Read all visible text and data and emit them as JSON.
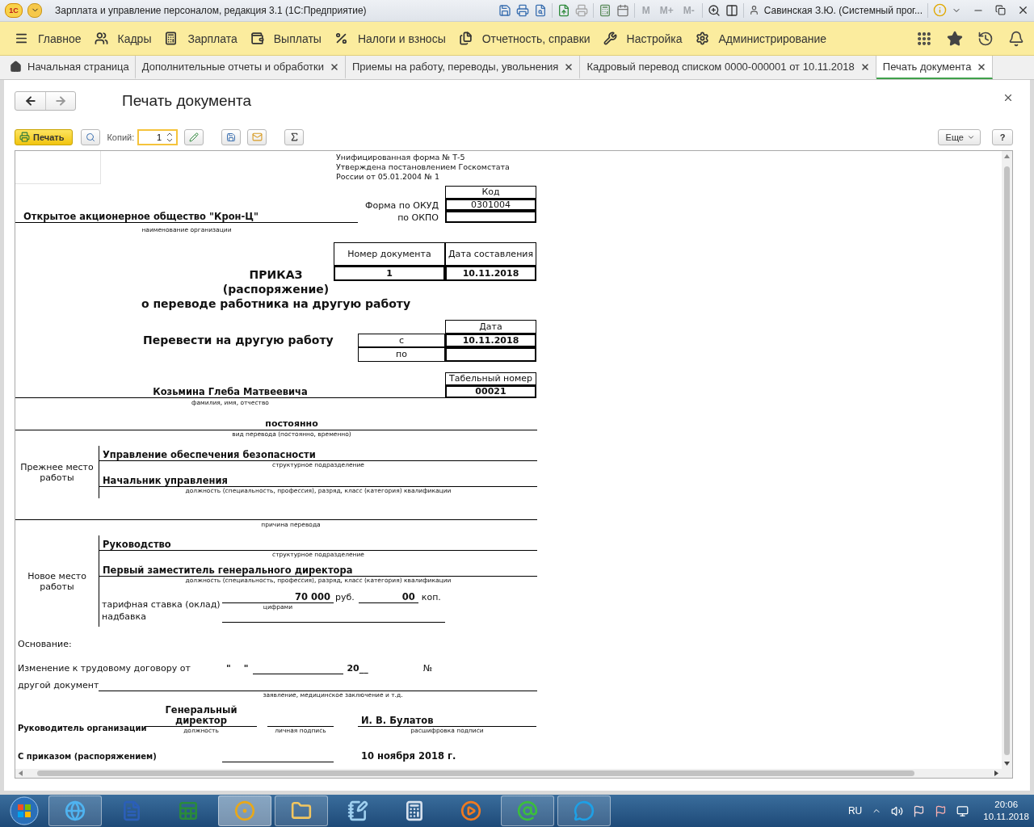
{
  "window": {
    "logo": "1С",
    "title": "Зарплата и управление персоналом, редакция 3.1  (1С:Предприятие)",
    "memory_buttons": [
      "M",
      "M+",
      "M-"
    ],
    "user": "Савинская З.Ю. (Системный прог..."
  },
  "menu": [
    {
      "label": "Главное"
    },
    {
      "label": "Кадры"
    },
    {
      "label": "Зарплата"
    },
    {
      "label": "Выплаты"
    },
    {
      "label": "Налоги и взносы"
    },
    {
      "label": "Отчетность, справки"
    },
    {
      "label": "Настройка"
    },
    {
      "label": "Администрирование"
    }
  ],
  "tabs": [
    {
      "label": "Начальная страница",
      "selected": false,
      "closable": false
    },
    {
      "label": "Дополнительные отчеты и обработки",
      "selected": false,
      "closable": true
    },
    {
      "label": "Приемы на работу, переводы, увольнения",
      "selected": false,
      "closable": true
    },
    {
      "label": "Кадровый перевод списком 0000-000001 от 10.11.2018",
      "selected": false,
      "closable": true
    },
    {
      "label": "Печать документа",
      "selected": true,
      "closable": true
    }
  ],
  "form": {
    "title": "Печать документа",
    "print": "Печать",
    "copies_label": "Копий:",
    "copies": "1",
    "more": "Еще",
    "help": "?"
  },
  "document": {
    "header_lines": [
      "Унифицированная форма № Т-5",
      "Утверждена постановлением Госкомстата",
      "России от 05.01.2004 № 1"
    ],
    "code_header": "Код",
    "okud_label": "Форма по ОКУД",
    "okud": "0301004",
    "okpo_label": "по ОКПО",
    "org": "Открытое акционерное общество \"Крон-Ц\"",
    "org_caption": "наименование организации",
    "number_header": "Номер документа",
    "date_header": "Дата составления",
    "number": "1",
    "date": "10.11.2018",
    "title": [
      "ПРИКАЗ",
      "(распоряжение)",
      "о переводе работника на другую работу"
    ],
    "transfer": "Перевести на другую работу",
    "date_column": "Дата",
    "from_label": "с",
    "from": "10.11.2018",
    "to_label": "по",
    "tab_header": "Табельный номер",
    "tab_number": "00021",
    "employee": "Козьмина Глеба Матвеевича",
    "employee_caption": "фамилия, имя, отчество",
    "transfer_kind": "постоянно",
    "transfer_kind_caption": "вид перевода (постоянно, временно)",
    "old_place": {
      "label": "Прежнее место работы",
      "department": "Управление обеспечения безопасности",
      "department_caption": "структурное подразделение",
      "position": "Начальник управления",
      "position_caption": "должность (специальность, профессия), разряд, класс (категория) квалификации"
    },
    "reason_caption": "причина перевода",
    "new_place": {
      "label": "Новое место работы",
      "department": "Руководство",
      "department_caption": "структурное подразделение",
      "position": "Первый заместитель генерального директора",
      "position_caption": "должность (специальность, профессия), разряд, класс (категория) квалификации",
      "rate_label": "тарифная ставка (оклад)",
      "rate": "70 000",
      "rub": "руб.",
      "kop_value": "00",
      "kop": "коп.",
      "digits_caption": "цифрами",
      "bonus_label": "надбавка"
    },
    "basis": "Основание:",
    "contract_label": "Изменение к трудовому договору от",
    "open_quote": "\"",
    "close_quote": "\"",
    "year": "20__",
    "number_sign": "№",
    "other_label": "другой документ",
    "other_caption": "заявление, медицинское заключение и т.д.",
    "head_label": "Руководитель организации",
    "head_position": "Генеральный директор",
    "position_caption": "должность",
    "signature_caption": "личная подпись",
    "head_name": "И. В. Булатов",
    "name_caption": "расшифровка подписи",
    "ack_label": "С приказом (распоряжением)",
    "ack_date": "10 ноября 2018 г."
  },
  "taskbar": {
    "apps": [
      {
        "running": true,
        "selected": false
      },
      {
        "running": false,
        "selected": false
      },
      {
        "running": false,
        "selected": false
      },
      {
        "running": true,
        "selected": true
      },
      {
        "running": true,
        "selected": false
      },
      {
        "running": false,
        "selected": false
      },
      {
        "running": false,
        "selected": false
      },
      {
        "running": false,
        "selected": false
      },
      {
        "running": true,
        "selected": false
      },
      {
        "running": true,
        "selected": false
      }
    ],
    "language": "RU",
    "time": "20:06",
    "date": "10.11.2018"
  }
}
